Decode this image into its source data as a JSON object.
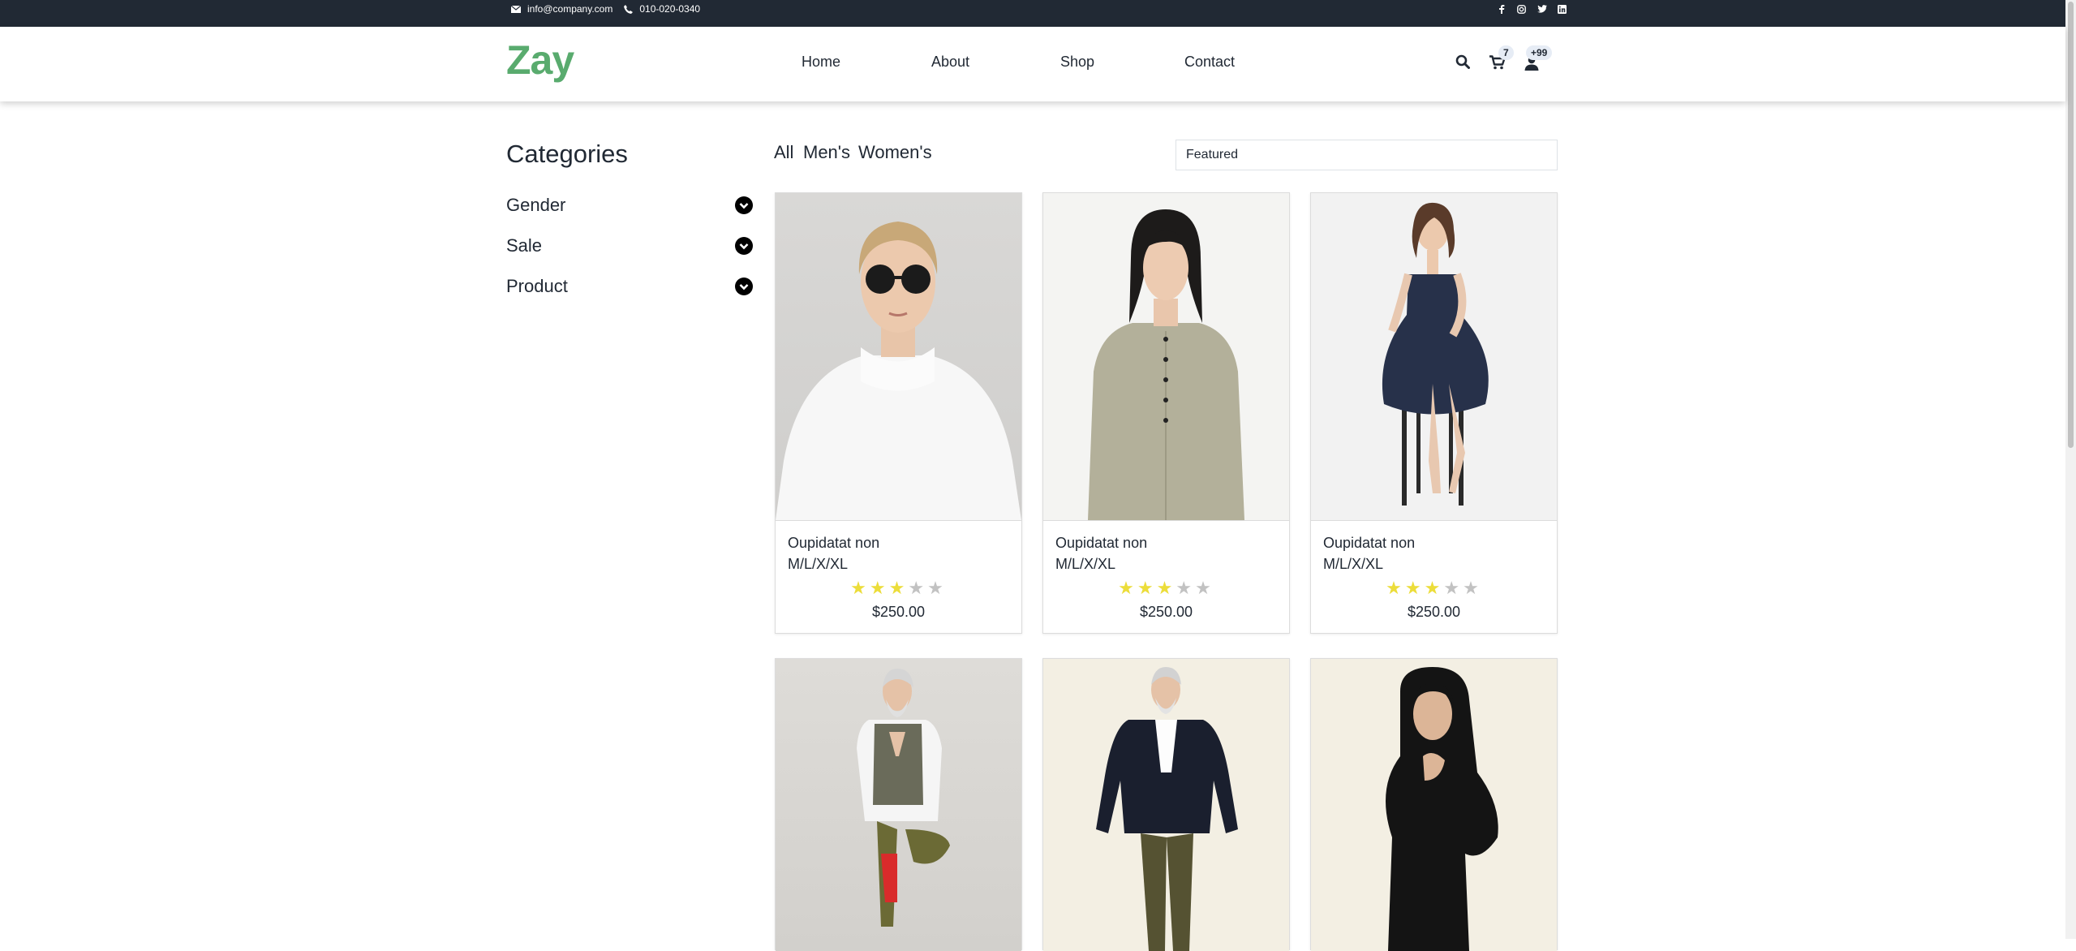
{
  "topbar": {
    "email": "info@company.com",
    "phone": "010-020-0340",
    "social_icons": [
      "facebook-icon",
      "instagram-icon",
      "twitter-icon",
      "linkedin-icon"
    ]
  },
  "nav": {
    "logo": "Zay",
    "links": [
      "Home",
      "About",
      "Shop",
      "Contact"
    ],
    "cart_count": "7",
    "user_count": "+99"
  },
  "sidebar": {
    "title": "Categories",
    "items": [
      {
        "label": "Gender"
      },
      {
        "label": "Sale"
      },
      {
        "label": "Product"
      }
    ]
  },
  "filters": {
    "tabs": [
      "All",
      "Men's",
      "Women's"
    ],
    "sort_value": "Featured"
  },
  "products": [
    {
      "name": "Oupidatat non",
      "sizes": "M/L/X/XL",
      "rating": 3,
      "price": "$250.00",
      "photo": "woman-sunglasses-white-turtleneck"
    },
    {
      "name": "Oupidatat non",
      "sizes": "M/L/X/XL",
      "rating": 3,
      "price": "$250.00",
      "photo": "woman-green-dress"
    },
    {
      "name": "Oupidatat non",
      "sizes": "M/L/X/XL",
      "rating": 3,
      "price": "$250.00",
      "photo": "woman-blue-dress-stool"
    },
    {
      "name": "",
      "sizes": "",
      "rating": null,
      "price": "",
      "photo": "older-man-yoga-pose"
    },
    {
      "name": "",
      "sizes": "",
      "rating": null,
      "price": "",
      "photo": "older-man-blazer-walking"
    },
    {
      "name": "",
      "sizes": "",
      "rating": null,
      "price": "",
      "photo": "woman-black-hijab"
    }
  ],
  "colors": {
    "brand": "#59ab6e",
    "dark": "#212934",
    "star_on": "#ecdd3a",
    "star_off": "#c2c2c2"
  }
}
